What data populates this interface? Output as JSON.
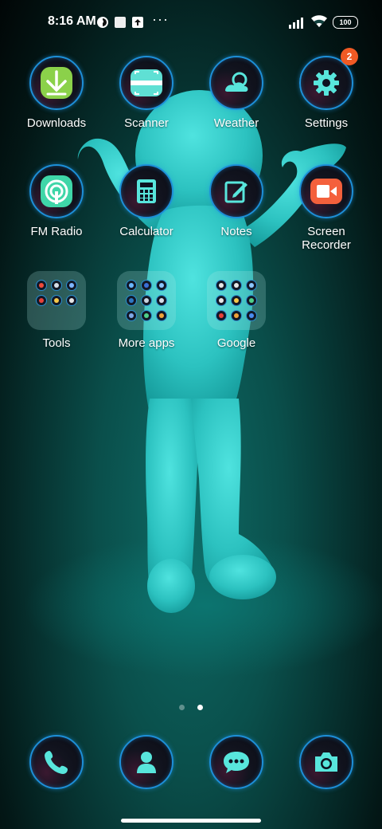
{
  "status_bar": {
    "time": "8:16 AM",
    "more": "···",
    "battery": "100",
    "icons": [
      "app-notification-icon",
      "square-notification-icon",
      "upload-icon",
      "signal-icon",
      "wifi-icon",
      "battery-icon"
    ]
  },
  "apps": {
    "downloads": "Downloads",
    "scanner": "Scanner",
    "weather": "Weather",
    "settings": "Settings",
    "settings_badge": "2",
    "fm_radio": "FM Radio",
    "calculator": "Calculator",
    "notes": "Notes",
    "screen_recorder": "Screen Recorder"
  },
  "folders": {
    "tools": "Tools",
    "more_apps": "More apps",
    "google": "Google"
  },
  "dock": {
    "icons": [
      "phone-icon",
      "contacts-icon",
      "messages-icon",
      "camera-icon"
    ]
  },
  "page_indicator": {
    "pages": 2,
    "current": 2
  },
  "colors": {
    "accent_ring": "#1d8fd8",
    "icon_cyan": "#58e6dc",
    "badge": "#f15a24",
    "figure": "#2fc8c6"
  }
}
